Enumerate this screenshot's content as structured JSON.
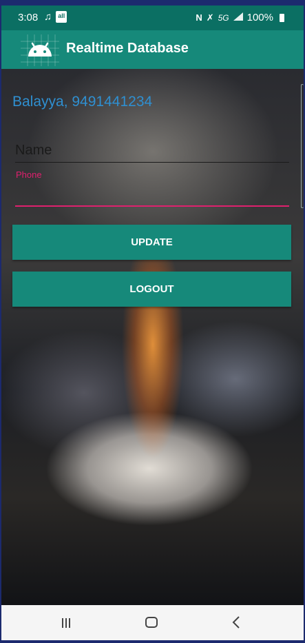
{
  "status_bar": {
    "time": "3:08",
    "left_icons": [
      "music-note-icon",
      "app-badge-icon"
    ],
    "app_badge_text": "all",
    "network": "5G",
    "battery": "100%"
  },
  "app_bar": {
    "title": "Realtime Database",
    "background": "#16897a"
  },
  "main": {
    "user_info": "Balayya, 9491441234",
    "name_placeholder": "Name",
    "name_value": "",
    "phone_label": "Phone",
    "phone_value": "",
    "update_label": "UPDATE",
    "logout_label": "LOGOUT"
  },
  "colors": {
    "accent": "#e0206e",
    "primary": "#16897a",
    "status_bar": "#0b6f63",
    "user_info_text": "#2f8fd0"
  }
}
